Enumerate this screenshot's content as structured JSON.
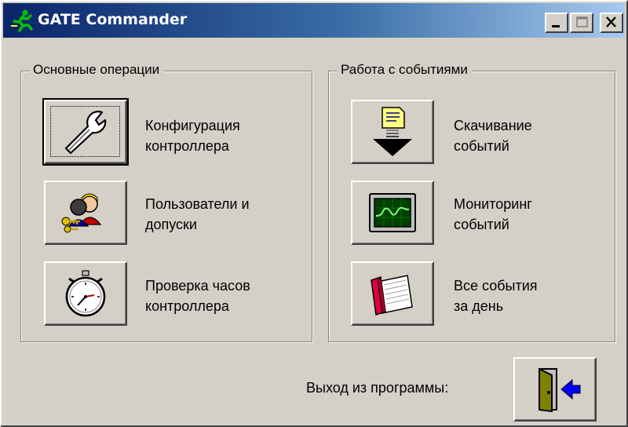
{
  "window": {
    "title": "GATE Commander",
    "controls": {
      "minimize_icon": "minimize-icon",
      "maximize_icon": "maximize-icon",
      "close_icon": "close-icon"
    }
  },
  "left_group": {
    "legend": "Основные операции",
    "buttons": [
      {
        "icon": "wrench-icon",
        "line1": "Конфигурация",
        "line2": "контроллера"
      },
      {
        "icon": "users-keys-icon",
        "line1": "Пользователи и",
        "line2": "допуски"
      },
      {
        "icon": "stopwatch-icon",
        "line1": "Проверка часов",
        "line2": "контроллера"
      }
    ]
  },
  "right_group": {
    "legend": "Работа с событиями",
    "buttons": [
      {
        "icon": "download-events-icon",
        "line1": "Скачивание",
        "line2": "событий"
      },
      {
        "icon": "monitor-icon",
        "line1": "Мониторинг",
        "line2": "событий"
      },
      {
        "icon": "book-icon",
        "line1": "Все события",
        "line2": "за день"
      }
    ]
  },
  "exit": {
    "label": "Выход из программы:",
    "icon": "exit-door-icon"
  }
}
